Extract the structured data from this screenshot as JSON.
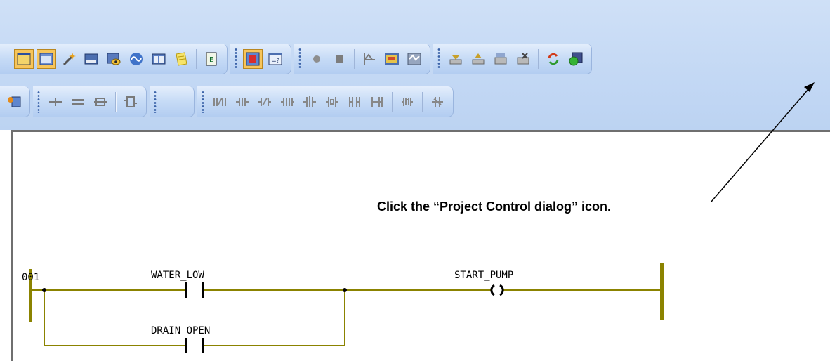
{
  "instruction": {
    "text": "Click the “Project Control dialog” icon."
  },
  "ladder": {
    "rung_number": "001",
    "contacts": [
      {
        "label": "WATER_LOW"
      },
      {
        "label": "DRAIN_OPEN"
      }
    ],
    "coil": {
      "label": "START_PUMP"
    }
  },
  "colors": {
    "rail": "#8b8300",
    "wire": "#8b8300",
    "toolbar_bg": "#c3d8f4",
    "pressed_button": "#f7c55a"
  },
  "toolbar": {
    "row1_icons": [
      "open-window-icon",
      "window-icon",
      "wand-icon",
      "keyboard-icon",
      "watch-icon",
      "scope-icon",
      "split-window-icon",
      "notes-icon",
      "document-icon",
      "project-tree-icon",
      "dialog-icon",
      "record-icon",
      "stop-icon",
      "graph-icon",
      "image-icon",
      "diagnostic-icon",
      "download-icon",
      "upload-icon",
      "compare-icon",
      "compile-icon",
      "refresh-icon",
      "project-control-icon"
    ],
    "row2_icons": [
      "configure-icon",
      "add-rung-icon",
      "delete-rung-icon",
      "branch-icon",
      "function-block-icon",
      "contact-nc-edit-icon",
      "contact-no-icon",
      "contact-nc-icon",
      "contact-pos-icon",
      "contact-neg-icon",
      "coil-icon",
      "coil-set-icon",
      "coil-reset-icon",
      "jump-icon",
      "return-icon"
    ]
  }
}
